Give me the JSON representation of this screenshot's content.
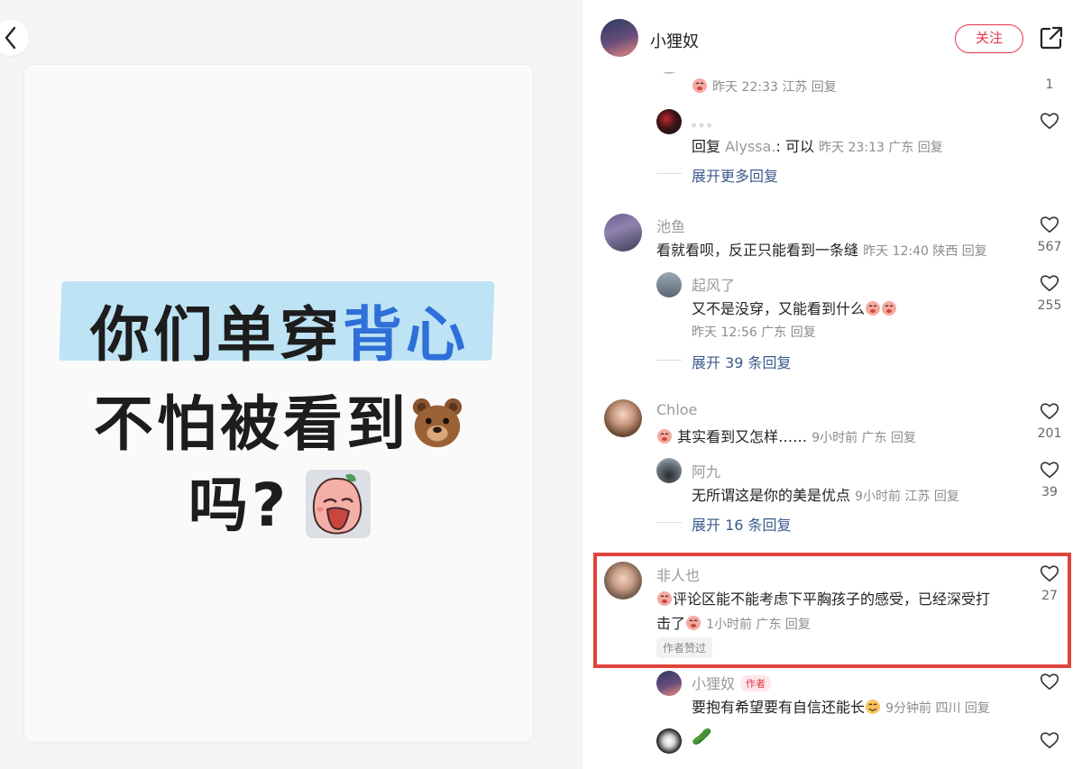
{
  "left": {
    "line1_black": "你们单穿",
    "line1_blue": "背心",
    "line2": "不怕被看到",
    "line3": "吗?"
  },
  "header": {
    "username": "小狸奴",
    "follow_label": "关注"
  },
  "comments": [
    {
      "meta": "昨天 22:33 江苏 回复",
      "likes": "1"
    },
    {
      "username": "。。。",
      "reply_prefix": "回复 ",
      "reply_target": "Alyssa.",
      "text": ": 可以",
      "meta": "昨天 23:13 广东 回复"
    },
    {
      "expand": "展开更多回复"
    },
    {
      "username": "池鱼",
      "text": "看就看呗，反正只能看到一条缝",
      "meta": "昨天 12:40 陕西 回复",
      "likes": "567"
    },
    {
      "username": "起风了",
      "text": "又不是没穿，又能看到什么",
      "meta": "昨天 12:56 广东 回复",
      "likes": "255"
    },
    {
      "expand": "展开 39 条回复"
    },
    {
      "username": "Chloe",
      "text": "其实看到又怎样……",
      "meta": "9小时前 广东 回复",
      "likes": "201"
    },
    {
      "username": "阿九",
      "text": "无所谓这是你的美是优点",
      "meta": "9小时前 江苏 回复",
      "likes": "39"
    },
    {
      "expand": "展开 16 条回复"
    },
    {
      "username": "非人也",
      "text_line1": "评论区能不能考虑下平胸孩子的感受，已经深受打",
      "text_line2": "击了",
      "meta": "1小时前 广东 回复",
      "likes": "27",
      "tag": "作者赞过"
    },
    {
      "username": "小狸奴",
      "author_tag": "作者",
      "text": "要抱有希望要有自信还能长",
      "meta": "9分钟前 四川 回复"
    },
    {
      "username": "🥒"
    }
  ],
  "colors": {
    "accent_red": "#e8334a",
    "link_blue": "#3b5a8c",
    "highlight_blue": "#bde3f4",
    "title_blue": "#2e6fd8"
  }
}
